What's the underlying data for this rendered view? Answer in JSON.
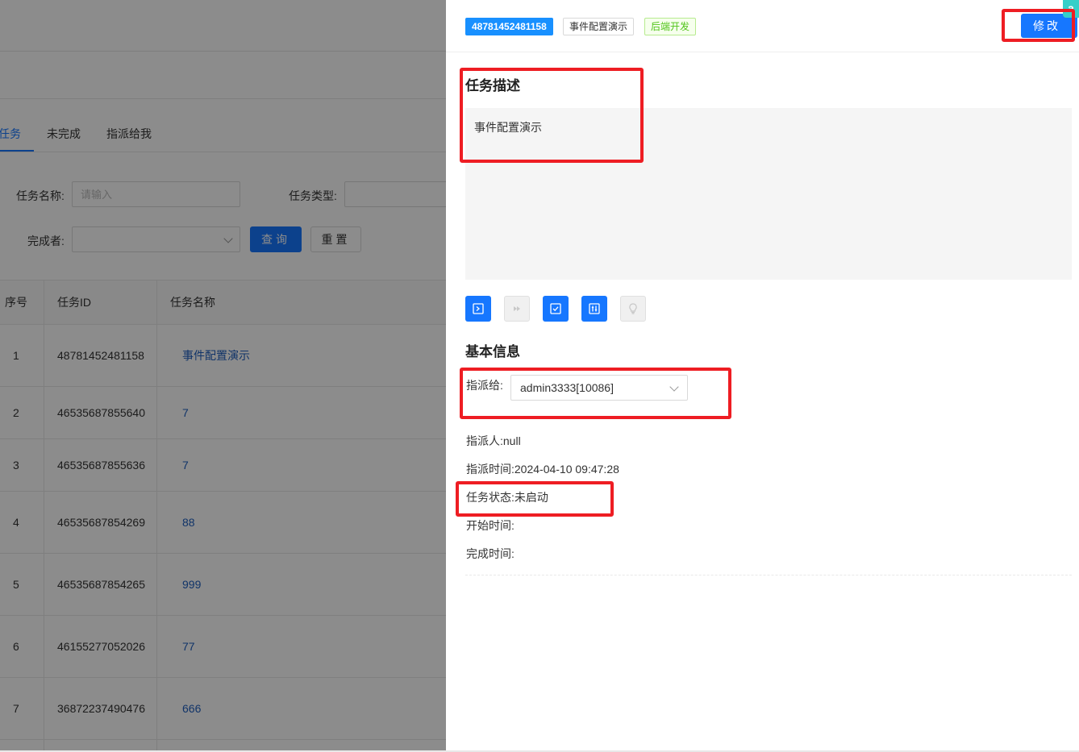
{
  "tabs": [
    "任务",
    "未完成",
    "指派给我"
  ],
  "filters": {
    "task_name_label": "任务名称:",
    "task_name_placeholder": "请输入",
    "task_type_label": "任务类型:",
    "finisher_label": "完成者:",
    "query_button": "查询",
    "reset_button": "重置"
  },
  "table": {
    "headers": [
      "序号",
      "任务ID",
      "任务名称"
    ],
    "rows": [
      {
        "no": "1",
        "id": "48781452481158",
        "name": "事件配置演示"
      },
      {
        "no": "2",
        "id": "46535687855640",
        "name": "7"
      },
      {
        "no": "3",
        "id": "46535687855636",
        "name": "7"
      },
      {
        "no": "4",
        "id": "46535687854269",
        "name": "88"
      },
      {
        "no": "5",
        "id": "46535687854265",
        "name": "999"
      },
      {
        "no": "6",
        "id": "46155277052026",
        "name": "77"
      },
      {
        "no": "7",
        "id": "36872237490476",
        "name": "666"
      }
    ]
  },
  "drawer": {
    "tag_id": "48781452481158",
    "tag_name": "事件配置演示",
    "tag_status": "后端开发",
    "edit_button": "修改",
    "corner_badge": "a",
    "desc_title": "任务描述",
    "desc_text": "事件配置演示",
    "basic_title": "基本信息",
    "assign_label": "指派给:",
    "assign_value": "admin3333[10086]",
    "assigner": "指派人:null",
    "assign_time": "指派时间:2024-04-10 09:47:28",
    "task_status": "任务状态:未启动",
    "start_time": "开始时间:",
    "finish_time": "完成时间:",
    "action_icons": [
      "terminal-icon",
      "fast-forward-icon",
      "checkbox-icon",
      "sliders-icon",
      "lightbulb-icon"
    ]
  },
  "colors": {
    "primary": "#1677ff",
    "highlight_red": "#ee1d23",
    "status_green": "#52c41a",
    "link_blue": "#1f5fbf"
  }
}
